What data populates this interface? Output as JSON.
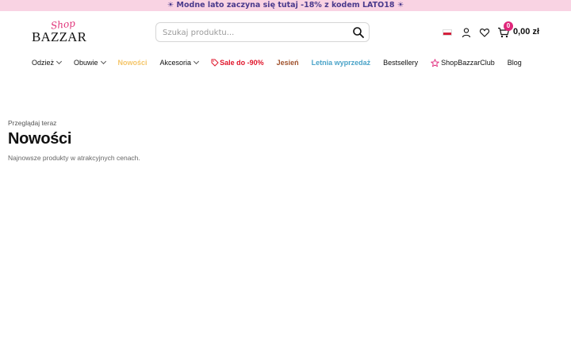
{
  "promo": {
    "text": "☀ Modne lato zaczyna się tutaj -18% z kodem LATO18 ☀",
    "bg": "#f9d3e3",
    "color": "#4a3a8c"
  },
  "logo": {
    "script": "Shop",
    "main": "BAZZAR"
  },
  "search": {
    "placeholder": "Szukaj produktu..."
  },
  "header": {
    "language_flag": "flag-pl",
    "icons": [
      "user-icon",
      "heart-icon",
      "cart-icon"
    ],
    "cart_count": "0",
    "cart_total": "0,00 zł"
  },
  "nav": {
    "items": [
      {
        "label": "Odzież",
        "dropdown": true,
        "color": "#111111"
      },
      {
        "label": "Obuwie",
        "dropdown": true,
        "color": "#111111"
      },
      {
        "label": "Nowości",
        "dropdown": false,
        "color": "#f5c66a"
      },
      {
        "label": "Akcesoria",
        "dropdown": true,
        "color": "#111111"
      },
      {
        "label": "Sale do -90%",
        "dropdown": false,
        "color": "#e0162b",
        "icon": "tag-icon"
      },
      {
        "label": "Jesień",
        "dropdown": false,
        "color": "#a0522d"
      },
      {
        "label": "Letnia wyprzedaż",
        "dropdown": false,
        "color": "#4aa3c8"
      },
      {
        "label": "Bestsellery",
        "dropdown": false,
        "color": "#111111"
      },
      {
        "label": "ShopBazzarClub",
        "dropdown": false,
        "color": "#111111",
        "icon": "star-icon"
      },
      {
        "label": "Blog",
        "dropdown": false,
        "color": "#111111"
      }
    ]
  },
  "main": {
    "eyebrow": "Przeglądaj teraz",
    "title": "Nowości",
    "subtitle": "Najnowsze produkty w atrakcyjnych cenach."
  }
}
